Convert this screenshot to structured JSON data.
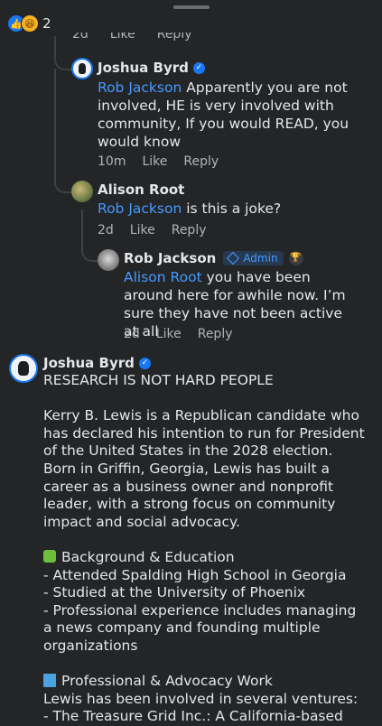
{
  "reactions": {
    "count": "2",
    "like_icon": "thumbs-up-icon",
    "haha_icon": "laughing-face-icon"
  },
  "cut_off_meta": {
    "time": "2d",
    "like": "Like",
    "reply": "Reply"
  },
  "comments": [
    {
      "author": "Joshua Byrd",
      "verified": true,
      "mention": "Rob Jackson",
      "text": " Apparently you are not involved, HE is very involved with community, If you would READ, you would know",
      "time": "10m",
      "like": "Like",
      "reply": "Reply"
    },
    {
      "author": "Alison Root",
      "mention": "Rob Jackson",
      "text": " is this a joke?",
      "time": "2d",
      "like": "Like",
      "reply": "Reply"
    },
    {
      "author": "Rob Jackson",
      "badge": "Admin",
      "mention": "Alison Root",
      "text": " you have been around here for awhile now. I’m sure they have not been active at all",
      "time": "2d",
      "like": "Like",
      "reply": "Reply"
    }
  ],
  "post": {
    "author": "Joshua Byrd",
    "verified": true,
    "line1": "RESEARCH IS NOT HARD PEOPLE",
    "para1": "Kerry B. Lewis is a Republican candidate who has declared his intention to run for President of the United States in the 2028 election. Born in Griffin, Georgia, Lewis has built a career as a business owner and nonprofit leader, with a strong focus on community impact and social advocacy.",
    "section1_title": "Background & Education",
    "section1_items": [
      "- Attended Spalding High School in Georgia",
      "- Studied at the University of Phoenix",
      "- Professional experience includes managing a news company and founding multiple organizations"
    ],
    "section2_title": "Professional & Advocacy Work",
    "section2_intro": "Lewis has been involved in several ventures:",
    "section2_item1": "- The Treasure Grid Inc.: A California-based"
  }
}
